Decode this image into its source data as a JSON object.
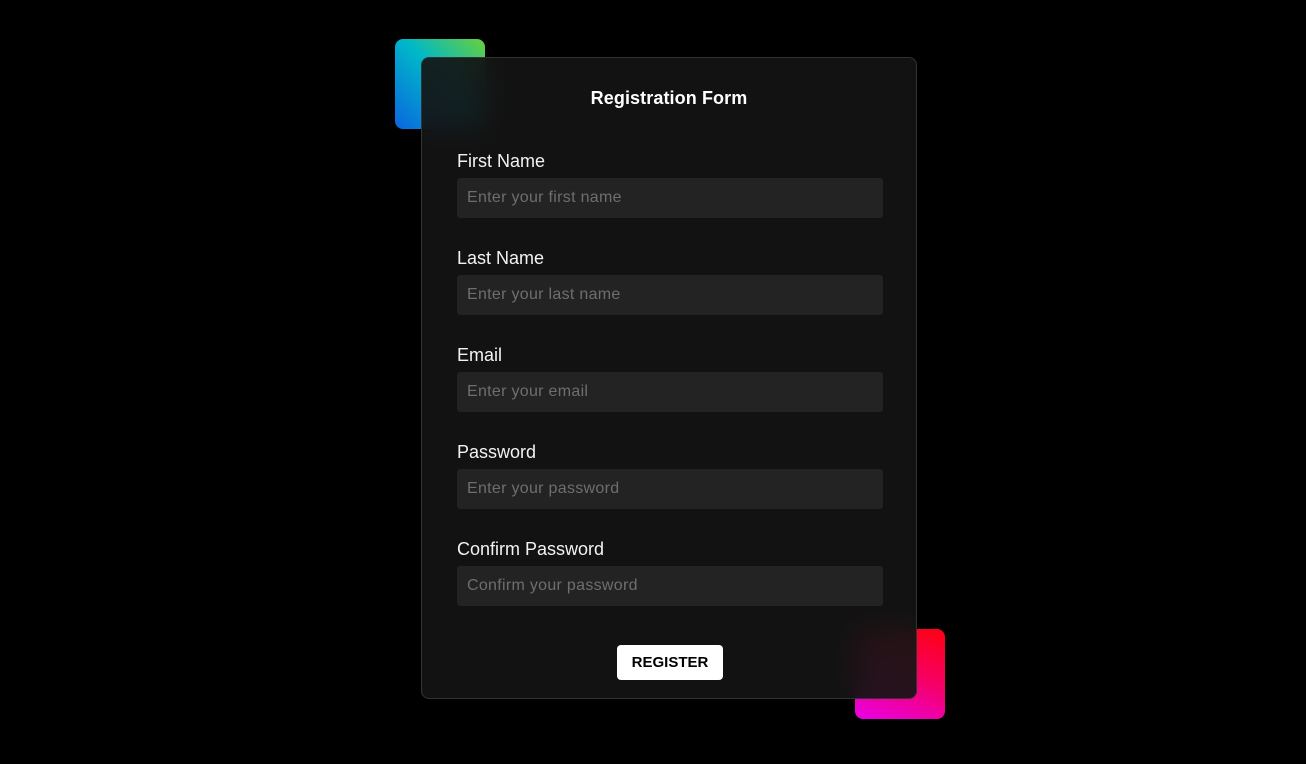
{
  "form": {
    "title": "Registration Form",
    "fields": [
      {
        "label": "First Name",
        "placeholder": "Enter your first name"
      },
      {
        "label": "Last Name",
        "placeholder": "Enter your last name"
      },
      {
        "label": "Email",
        "placeholder": "Enter your email"
      },
      {
        "label": "Password",
        "placeholder": "Enter your password"
      },
      {
        "label": "Confirm Password",
        "placeholder": "Confirm your password"
      }
    ],
    "submit_label": "REGISTER"
  },
  "colors": {
    "background": "#000000",
    "card": "#131313",
    "input": "#232323",
    "accent_top_left": [
      "#6ad03a",
      "#00b8c8",
      "#0a66e0"
    ],
    "accent_bottom_right": [
      "#ff0010",
      "#f5006a",
      "#e800e8"
    ]
  }
}
